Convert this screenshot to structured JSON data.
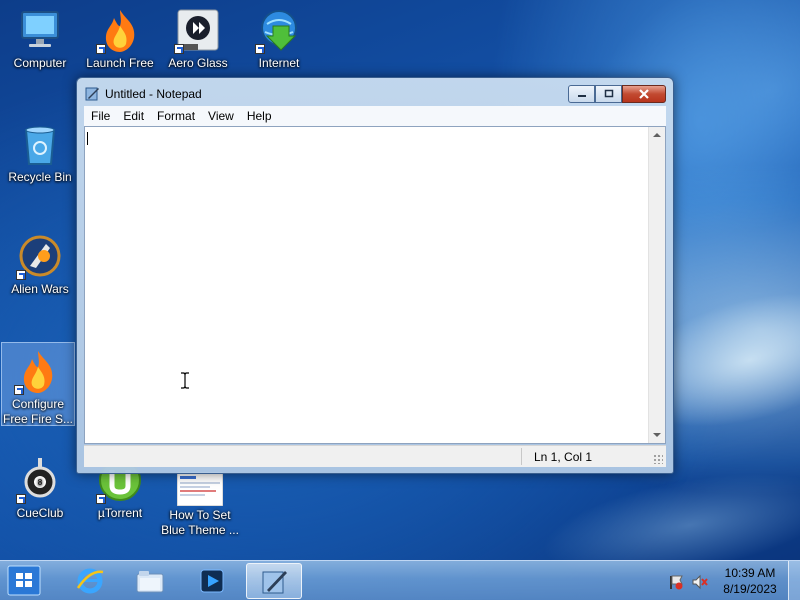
{
  "desktop": {
    "icons": [
      {
        "label": "Computer",
        "icon": "computer-icon"
      },
      {
        "label": "Launch Free",
        "icon": "flame-icon"
      },
      {
        "label": "Aero Glass",
        "icon": "aero-glass-icon"
      },
      {
        "label": "Internet",
        "icon": "internet-download-icon"
      },
      {
        "label": "Recycle Bin",
        "icon": "recycle-bin-icon"
      },
      {
        "label": "Alien Wars",
        "icon": "alien-wars-icon"
      },
      {
        "label": "Configure\nFree Fire S...",
        "icon": "flame-icon"
      },
      {
        "label": "CueClub",
        "icon": "cueclub-icon"
      },
      {
        "label": "µTorrent",
        "icon": "utorrent-icon"
      },
      {
        "label": "How To Set\nBlue Theme ...",
        "icon": "document-thumbnail-icon"
      }
    ]
  },
  "notepad": {
    "title": "Untitled - Notepad",
    "menu": [
      "File",
      "Edit",
      "Format",
      "View",
      "Help"
    ],
    "content": "",
    "status": "Ln 1, Col 1"
  },
  "taskbar": {
    "pinned": [
      "start-button",
      "internet-explorer-icon",
      "file-explorer-icon",
      "media-player-icon",
      "notepad-icon"
    ],
    "clock_time": "10:39 AM",
    "clock_date": "8/19/2023"
  },
  "colors": {
    "desktop_bg": "#1557b0",
    "close_button": "#c24a31",
    "taskbar": "#6ea0d7"
  }
}
